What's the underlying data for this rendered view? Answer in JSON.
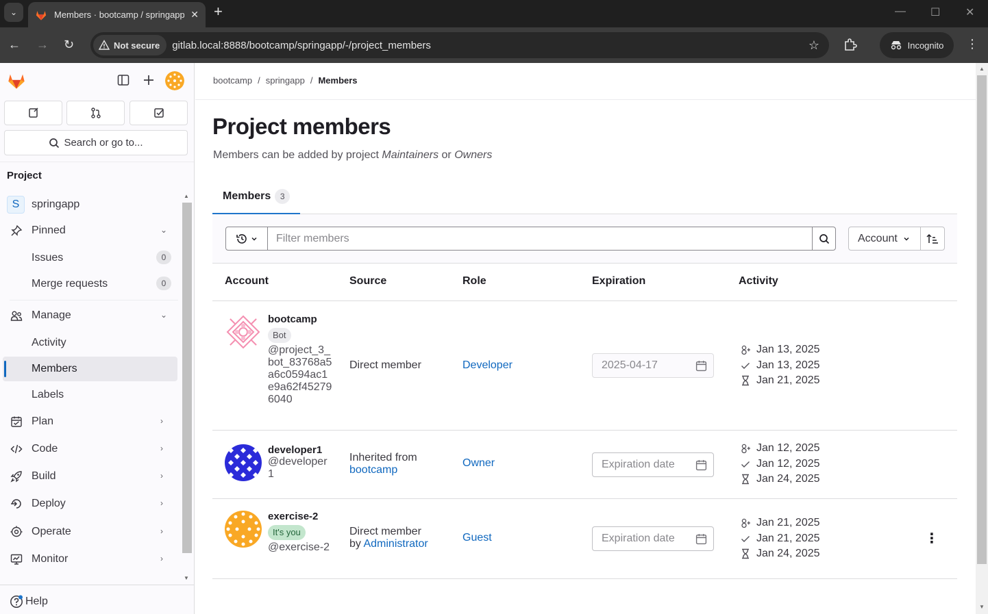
{
  "browser": {
    "tab_title": "Members · bootcamp / springapp · GitLab",
    "new_tab": "+",
    "security_label": "Not secure",
    "url": "gitlab.local:8888/bootcamp/springapp/-/project_members",
    "incognito_label": "Incognito"
  },
  "sidebar": {
    "search_label": "Search or go to...",
    "section_title": "Project",
    "project_initial": "S",
    "project_name": "springapp",
    "pinned_label": "Pinned",
    "issues_label": "Issues",
    "issues_count": "0",
    "mr_label": "Merge requests",
    "mr_count": "0",
    "manage_label": "Manage",
    "activity_label": "Activity",
    "members_label": "Members",
    "labels_label": "Labels",
    "plan_label": "Plan",
    "code_label": "Code",
    "build_label": "Build",
    "deploy_label": "Deploy",
    "operate_label": "Operate",
    "monitor_label": "Monitor",
    "help_label": "Help"
  },
  "breadcrumb": {
    "group": "bootcamp",
    "project": "springapp",
    "current": "Members",
    "separator": "/"
  },
  "page": {
    "title": "Project members",
    "subtitle_prefix": "Members can be added by project ",
    "subtitle_role1": "Maintainers",
    "subtitle_or": " or ",
    "subtitle_role2": "Owners"
  },
  "tabs": {
    "members_label": "Members",
    "members_count": "3"
  },
  "filter": {
    "placeholder": "Filter members",
    "sort_label": "Account"
  },
  "table": {
    "headers": {
      "account": "Account",
      "source": "Source",
      "role": "Role",
      "expiration": "Expiration",
      "activity": "Activity"
    },
    "rows": [
      {
        "name": "bootcamp",
        "badge": "Bot",
        "username": "@project_3_bot_83768a5a6c0594ac1e9a62f452796040",
        "source_text": "Direct member",
        "role": "Developer",
        "expiration": "2025-04-17",
        "created": "Jan 13, 2025",
        "last_access": "Jan 13, 2025",
        "last_activity": "Jan 21, 2025"
      },
      {
        "name": "developer1",
        "username": "@developer1",
        "source_text": "Inherited from",
        "source_link": "bootcamp",
        "role": "Owner",
        "expiration_placeholder": "Expiration date",
        "created": "Jan 12, 2025",
        "last_access": "Jan 12, 2025",
        "last_activity": "Jan 24, 2025"
      },
      {
        "name": "exercise-2",
        "badge": "It's you",
        "username": "@exercise-2",
        "source_text": "Direct member",
        "source_by": "by ",
        "source_link": "Administrator",
        "role": "Guest",
        "expiration_placeholder": "Expiration date",
        "created": "Jan 21, 2025",
        "last_access": "Jan 21, 2025",
        "last_activity": "Jan 24, 2025"
      }
    ]
  },
  "colors": {
    "link": "#1068bf",
    "tab_active": "#1f75cb",
    "gitlab_orange": "#fc6d26"
  }
}
